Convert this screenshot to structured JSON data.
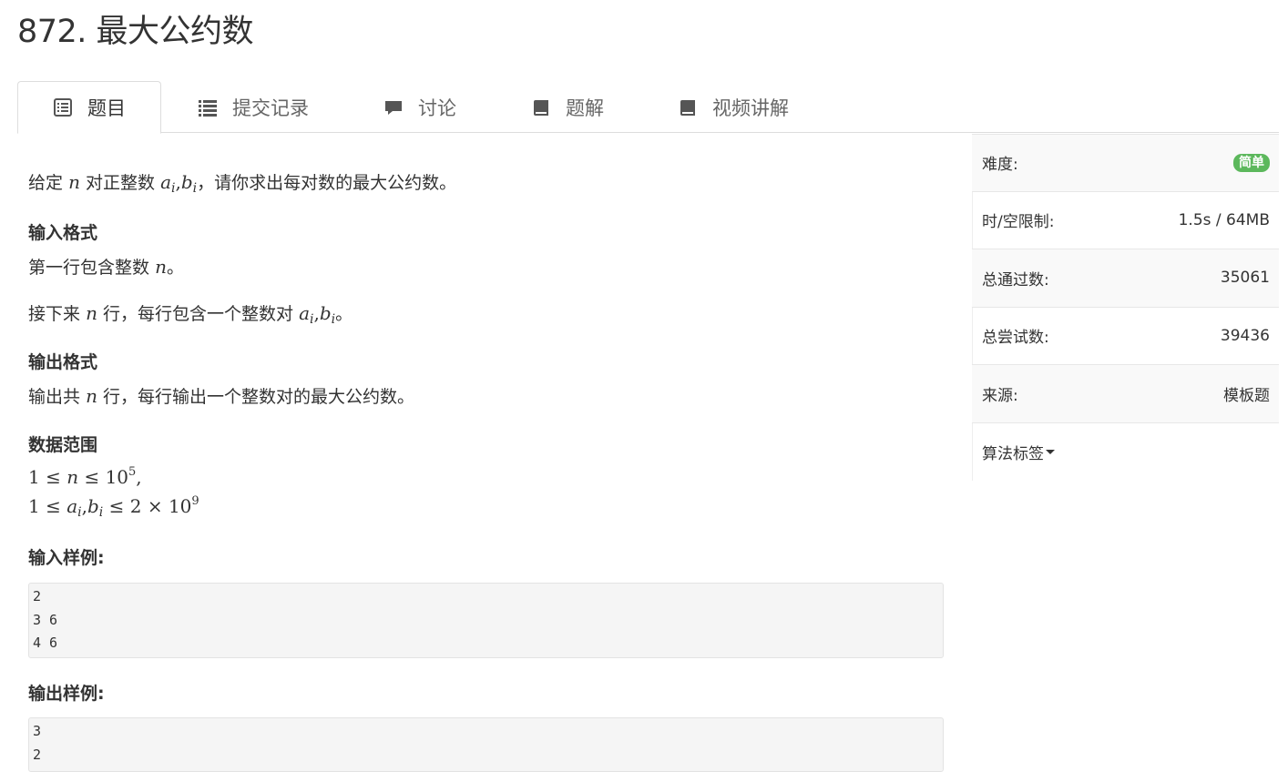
{
  "title": "872. 最大公约数",
  "tabs": [
    {
      "label": "题目",
      "icon": "list-alt-icon"
    },
    {
      "label": "提交记录",
      "icon": "list-icon"
    },
    {
      "label": "讨论",
      "icon": "comment-icon"
    },
    {
      "label": "题解",
      "icon": "book-icon"
    },
    {
      "label": "视频讲解",
      "icon": "book-icon"
    }
  ],
  "problem": {
    "desc": {
      "p1": "给定",
      "n": "n",
      "p2": "对正整数",
      "a": "a",
      "i": "i",
      "comma": ",",
      "b": "b",
      "p3": "，请你求出每对数的最大公约数。"
    },
    "input_heading": "输入格式",
    "input_line1": {
      "p1": "第一行包含整数",
      "n": "n",
      "p2": "。"
    },
    "input_line2": {
      "p1": "接下来",
      "n": "n",
      "p2": "行，每行包含一个整数对",
      "a": "a",
      "i": "i",
      "comma": ",",
      "b": "b",
      "p3": "。"
    },
    "output_heading": "输出格式",
    "output_line": {
      "p1": "输出共",
      "n": "n",
      "p2": "行，每行输出一个整数对的最大公约数。"
    },
    "range_heading": "数据范围",
    "range1": {
      "a": "1 ≤ ",
      "n": "n",
      "b": " ≤ 10",
      "exp": "5",
      "c": ","
    },
    "range2": {
      "a": "1 ≤ ",
      "ai": "a",
      "i": "i",
      "comma": ",",
      "bi": "b",
      "b": " ≤ 2 × 10",
      "exp": "9"
    },
    "sample_input_heading": "输入样例:",
    "sample_input": [
      "2",
      "3 6",
      "4 6"
    ],
    "sample_output_heading": "输出样例:",
    "sample_output": [
      "3",
      "2"
    ]
  },
  "sidebar": {
    "difficulty_label": "难度:",
    "difficulty_value": "简单",
    "difficulty_color": "#5cb85c",
    "limit_label": "时/空限制:",
    "limit_value": "1.5s / 64MB",
    "passed_label": "总通过数:",
    "passed_value": "35061",
    "tried_label": "总尝试数:",
    "tried_value": "39436",
    "source_label": "来源:",
    "source_value": "模板题",
    "tags_label": "算法标签"
  }
}
